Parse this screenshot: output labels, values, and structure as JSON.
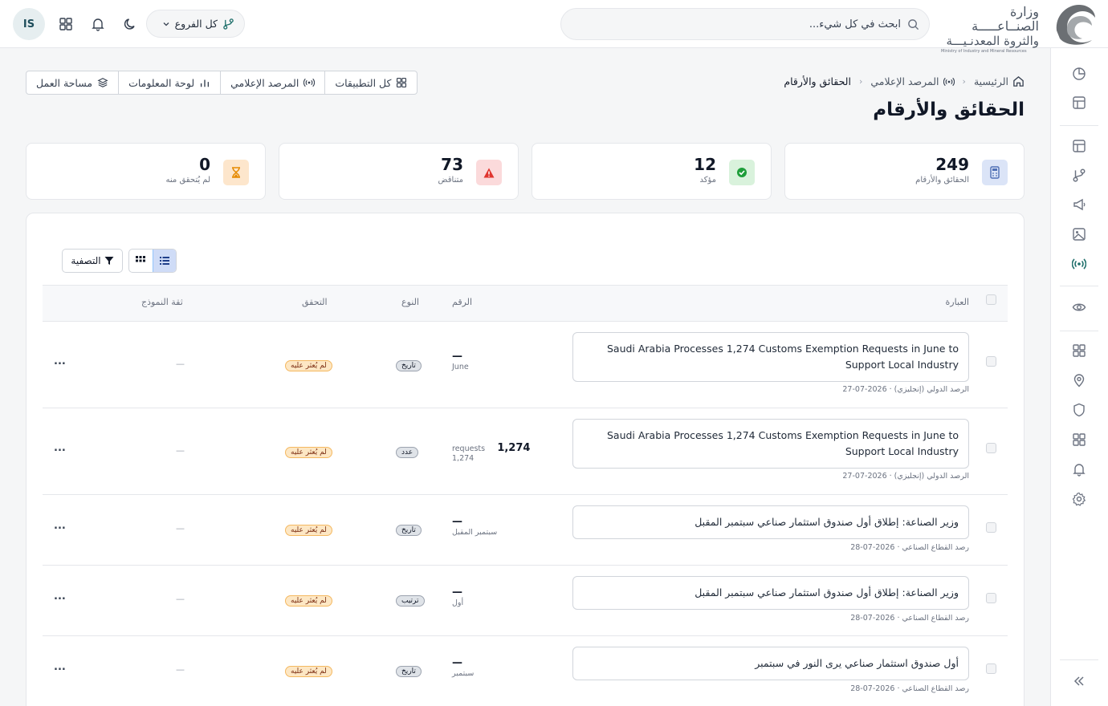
{
  "header": {
    "logo_ar_line1": "وزارة الصنــاعـــــة",
    "logo_ar_line2": "والثروة المعدنـيـــة",
    "logo_en": "Ministry of Industry and Mineral Resources",
    "search_placeholder": "ابحث في كل شيء...",
    "branch_label": "كل الفروع",
    "avatar_initials": "IS"
  },
  "breadcrumb": {
    "home": "الرئيسية",
    "section": "المرصد الإعلامي",
    "current": "الحقائق والأرقام"
  },
  "page_title": "الحقائق والأرقام",
  "quicknav": {
    "all_apps": "كل التطبيقات",
    "observatory": "المرصد الإعلامي",
    "dashboard": "لوحة المعلومات",
    "workspace": "مساحة العمل"
  },
  "stats": [
    {
      "value": "249",
      "label": "الحقائق والأرقام",
      "color": "#dbe4f7"
    },
    {
      "value": "12",
      "label": "مؤكد",
      "color": "#d9f2dc"
    },
    {
      "value": "73",
      "label": "متناقض",
      "color": "#fbdadb"
    },
    {
      "value": "0",
      "label": "لم يُتحقق منه",
      "color": "#fde6cc"
    }
  ],
  "toolbar": {
    "filter_label": "التصفية"
  },
  "table": {
    "headers": {
      "phrase": "العبارة",
      "number": "الرقم",
      "type": "النوع",
      "verification": "التحقق",
      "confidence": "ثقة النموذج"
    },
    "rows": [
      {
        "phrase": "Saudi Arabia Processes 1,274 Customs Exemption Requests in June to Support Local Industry",
        "meta": "الرصد الدولي (إنجليزي) · 2026-07-27",
        "number": "—",
        "number_sub": "June",
        "type": "تاريخ",
        "verification": "لم يُعثر عليه",
        "confidence": "—",
        "more": "..."
      },
      {
        "phrase": "Saudi Arabia Processes 1,274 Customs Exemption Requests in June to Support Local Industry",
        "meta": "الرصد الدولي (إنجليزي) · 2026-07-27",
        "number": "1,274",
        "number_unit": "requests",
        "number_sub": "1,274",
        "type": "عدد",
        "verification": "لم يُعثر عليه",
        "confidence": "—",
        "more": "..."
      },
      {
        "phrase": "وزير الصناعة: إطلاق أول صندوق استثمار صناعي سبتمبر المقبل",
        "meta": "رصد القطاع الصناعي · 2026-07-28",
        "number": "—",
        "number_sub": "سبتمبر المقبل",
        "type": "تاريخ",
        "verification": "لم يُعثر عليه",
        "confidence": "—",
        "more": "..."
      },
      {
        "phrase": "وزير الصناعة: إطلاق أول صندوق استثمار صناعي سبتمبر المقبل",
        "meta": "رصد القطاع الصناعي · 2026-07-28",
        "number": "—",
        "number_sub": "أول",
        "type": "ترتيب",
        "verification": "لم يُعثر عليه",
        "confidence": "—",
        "more": "..."
      },
      {
        "phrase": "أول صندوق استثمار صناعي يرى النور في سبتمبر",
        "meta": "رصد القطاع الصناعي · 2026-07-28",
        "number": "—",
        "number_sub": "سبتمبر",
        "type": "تاريخ",
        "verification": "لم يُعثر عليه",
        "confidence": "—",
        "more": "..."
      }
    ]
  },
  "colors": {
    "accent": "#1f6f6b",
    "badge_unverified_bg": "#fde7c4",
    "active_toggle": "#cfdcf7"
  },
  "icons": {
    "sidebar": [
      "chart-pie-icon",
      "layout-icon",
      "layout-icon",
      "branch-icon",
      "megaphone-icon",
      "image-icon",
      "broadcast-icon",
      "eye-icon",
      "grid-icon",
      "location-icon",
      "shield-icon",
      "grid-icon",
      "bell-icon",
      "settings-icon",
      "collapse-icon"
    ]
  }
}
